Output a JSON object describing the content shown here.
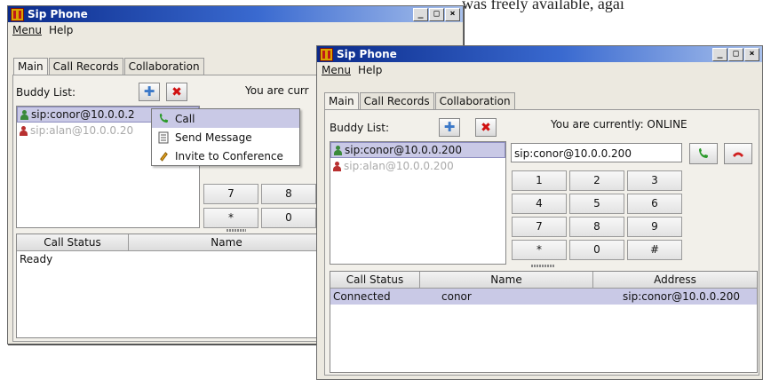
{
  "background_text": "was freely available, agai",
  "colors": {
    "accent": "#c9c9e6",
    "titlebar": "#0a2a8a",
    "call_green": "#2a9a2a",
    "hangup_red": "#d02020"
  },
  "window1": {
    "title": "Sip Phone",
    "title_buttons": [
      "_",
      "□",
      "×"
    ],
    "menu": [
      "Menu",
      "Help"
    ],
    "tabs": [
      "Main",
      "Call Records",
      "Collaboration"
    ],
    "buddy_label": "Buddy List:",
    "status_text": "You are curr",
    "buddies": [
      "sip:conor@10.0.0.2",
      "sip:alan@10.0.0.20"
    ],
    "keypad_visible": [
      "7",
      "8",
      "*",
      "0"
    ],
    "context_menu": [
      "Call",
      "Send Message",
      "Invite to Conference"
    ],
    "table_headers": [
      "Call Status",
      "Name"
    ],
    "rows": [
      {
        "status": "Ready"
      }
    ]
  },
  "window2": {
    "title": "Sip Phone",
    "title_buttons": [
      "_",
      "□",
      "×"
    ],
    "menu": [
      "Menu",
      "Help"
    ],
    "tabs": [
      "Main",
      "Call Records",
      "Collaboration"
    ],
    "buddy_label": "Buddy List:",
    "status_text": "You are currently: ONLINE",
    "buddies": [
      "sip:conor@10.0.0.200",
      "sip:alan@10.0.0.200"
    ],
    "dial_value": "sip:conor@10.0.0.200",
    "keypad": [
      "1",
      "2",
      "3",
      "4",
      "5",
      "6",
      "7",
      "8",
      "9",
      "*",
      "0",
      "#"
    ],
    "table_headers": [
      "Call Status",
      "Name",
      "Address"
    ],
    "rows": [
      {
        "status": "Connected",
        "name": "conor",
        "address": "sip:conor@10.0.0.200"
      }
    ]
  }
}
